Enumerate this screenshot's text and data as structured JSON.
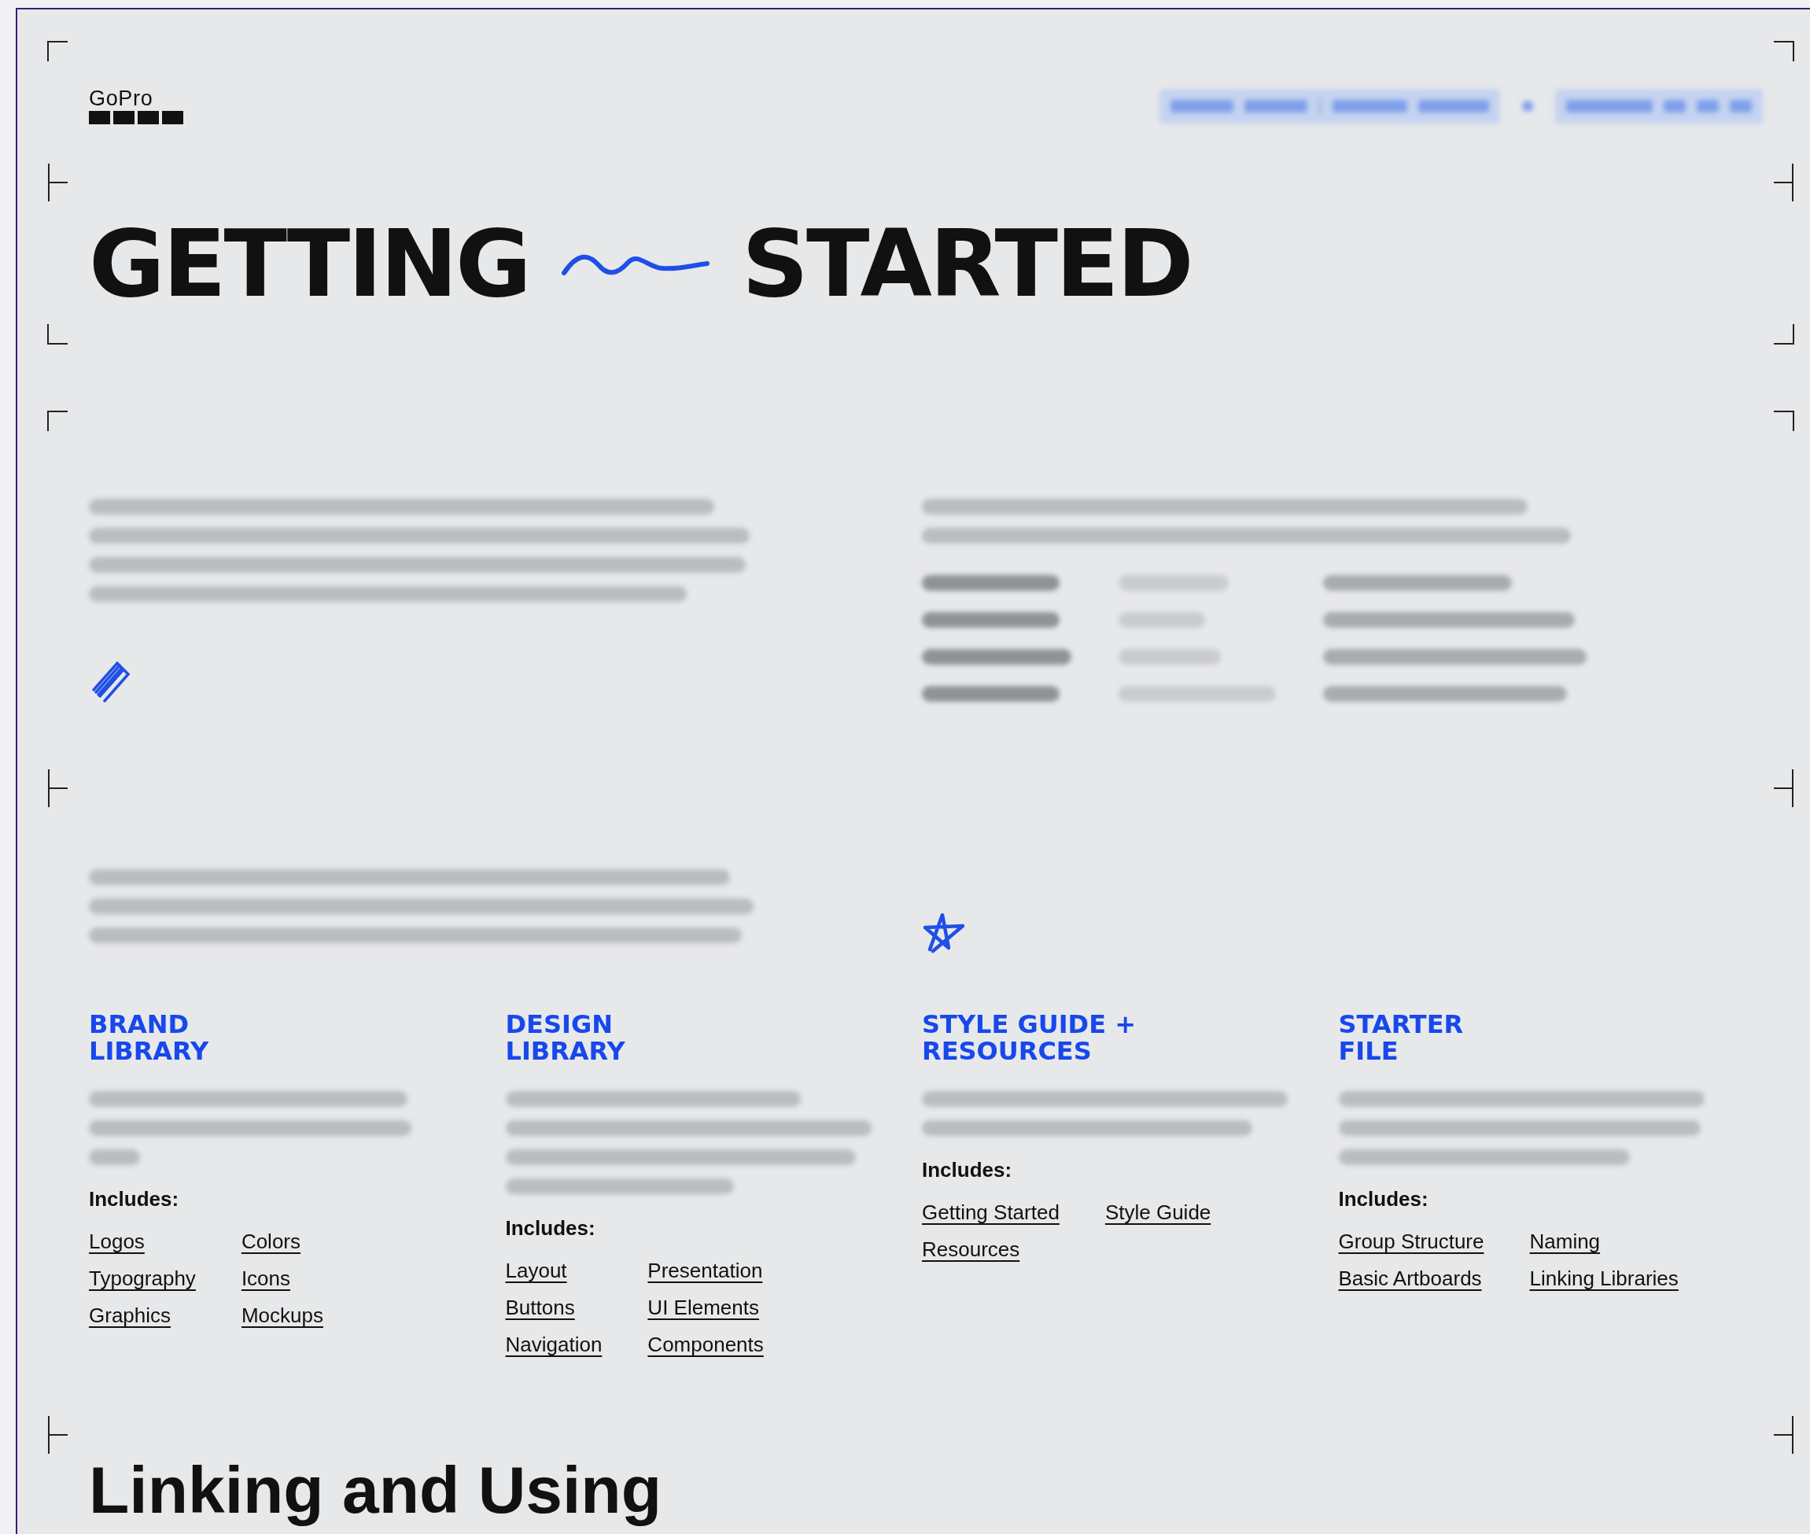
{
  "header": {
    "logo": "GoPro"
  },
  "title": {
    "left": "GETTING",
    "right": "STARTED"
  },
  "sections": [
    {
      "title_lines": [
        "BRAND",
        "LIBRARY"
      ],
      "includes_label": "Includes:",
      "links": [
        "Logos",
        "Colors",
        "Typography",
        "Icons",
        "Graphics",
        "Mockups"
      ]
    },
    {
      "title_lines": [
        "DESIGN",
        "LIBRARY"
      ],
      "includes_label": "Includes:",
      "links": [
        "Layout",
        "Presentation",
        "Buttons",
        "UI Elements",
        "Navigation",
        "Components"
      ]
    },
    {
      "title_lines": [
        "STYLE GUIDE +",
        "RESOURCES"
      ],
      "includes_label": "Includes:",
      "links": [
        "Getting Started",
        "Style Guide",
        "Resources"
      ]
    },
    {
      "title_lines": [
        "STARTER",
        "FILE"
      ],
      "includes_label": "Includes:",
      "links": [
        "Group Structure",
        "Naming",
        "Basic Artboards",
        "Linking Libraries"
      ]
    }
  ],
  "next_heading": "Linking and Using"
}
